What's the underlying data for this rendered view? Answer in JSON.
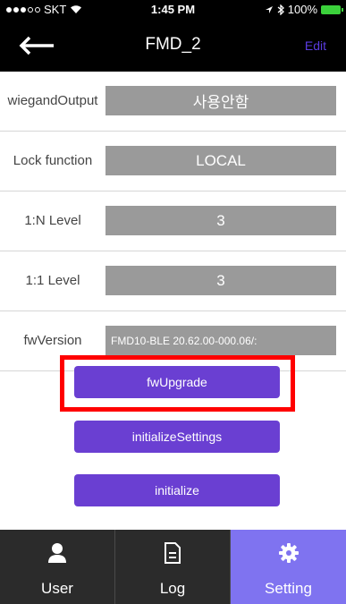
{
  "status_bar": {
    "carrier": "SKT",
    "time": "1:45 PM",
    "battery": "100%"
  },
  "nav": {
    "title": "FMD_2",
    "edit_label": "Edit"
  },
  "settings": [
    {
      "label": "wiegandOutput",
      "value": "사용안함"
    },
    {
      "label": "Lock function",
      "value": "LOCAL"
    },
    {
      "label": "1:N Level",
      "value": "3"
    },
    {
      "label": "1:1 Level",
      "value": "3"
    },
    {
      "label": "fwVersion",
      "value": "FMD10-BLE 20.62.00-000.06/:"
    }
  ],
  "actions": {
    "fw_upgrade": "fwUpgrade",
    "initialize_settings": "initializeSettings",
    "initialize": "initialize"
  },
  "tabs": [
    {
      "label": "User",
      "icon": "user-icon"
    },
    {
      "label": "Log",
      "icon": "document-icon"
    },
    {
      "label": "Setting",
      "icon": "gear-icon"
    }
  ],
  "colors": {
    "accent": "#6a3fd2",
    "active_tab": "#7f73f0",
    "highlight": "#ff0000"
  }
}
